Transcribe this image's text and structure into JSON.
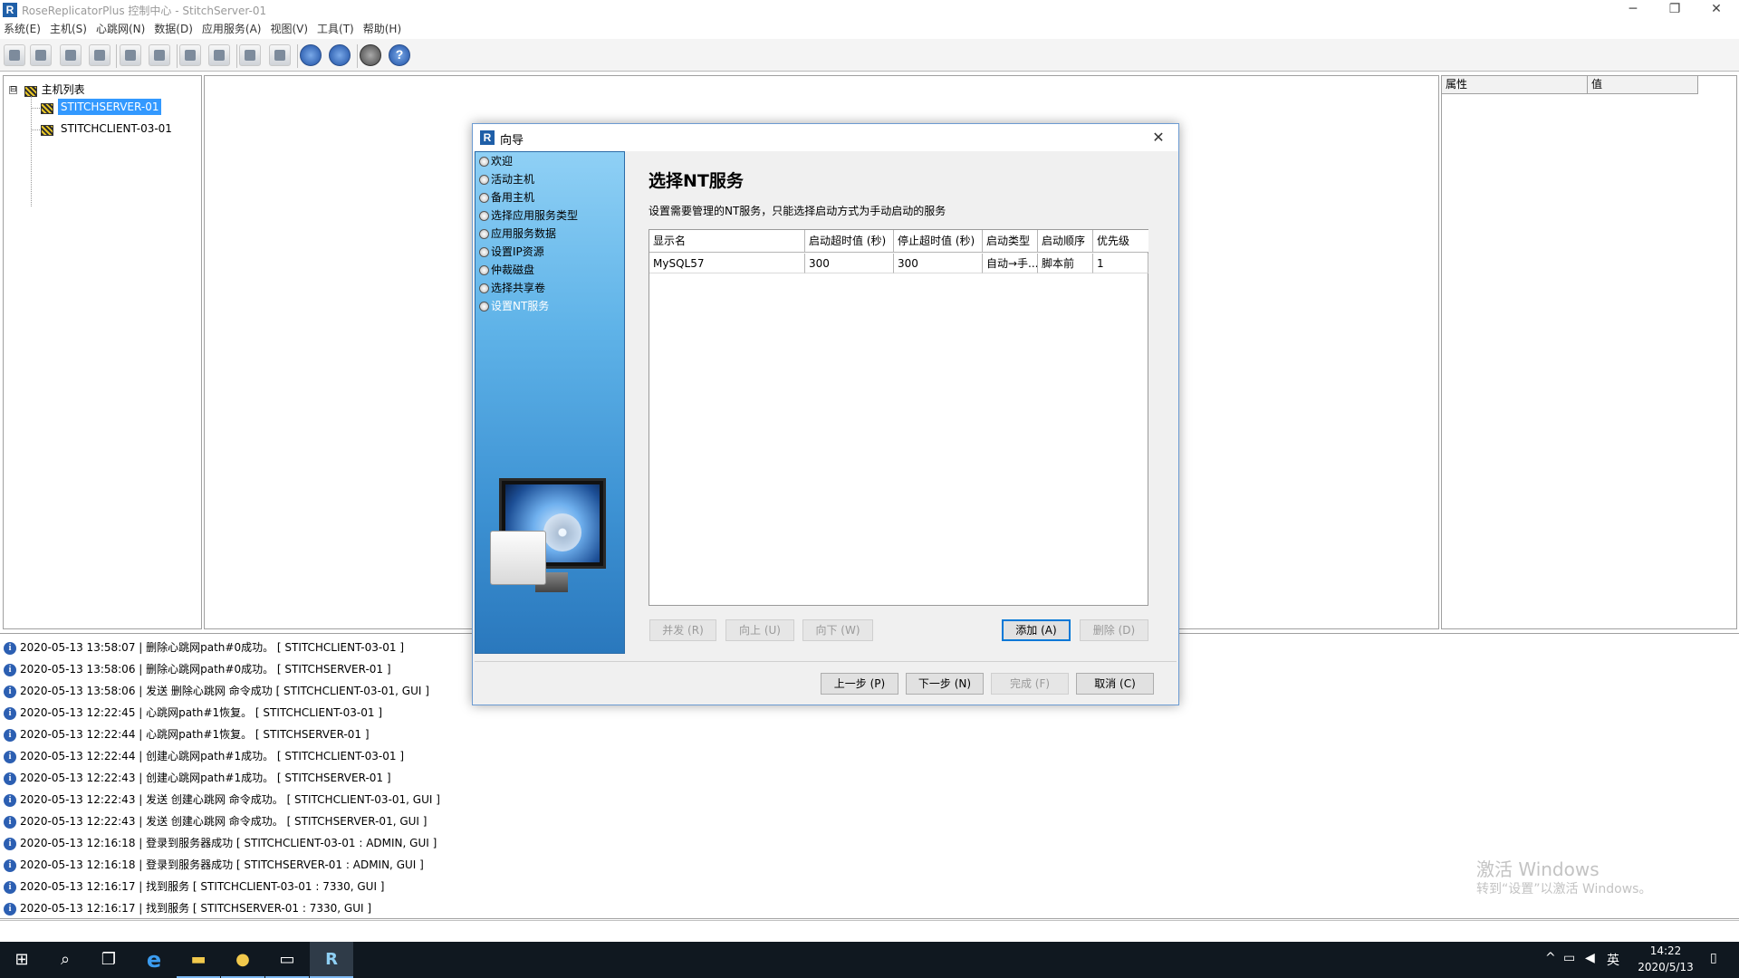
{
  "window": {
    "title": "RoseReplicatorPlus 控制中心   -   StitchServer-01",
    "icon_letter": "R",
    "minimize_glyph": "─",
    "restore_glyph": "❐",
    "close_glyph": "✕"
  },
  "menu": [
    "系统(E)",
    "主机(S)",
    "心跳网(N)",
    "数据(D)",
    "应用服务(A)",
    "视图(V)",
    "工具(T)",
    "帮助(H)"
  ],
  "toolbar": {
    "icons": [
      "key-icon",
      "console-icon",
      "server-icon",
      "settings-gear-icon",
      "download-icon",
      "upload-icon",
      "monitor-out-icon",
      "monitor-in-icon",
      "copy-icon",
      "paste-icon",
      "globe-icon",
      "globe-star-icon",
      "refresh-icon",
      "help-icon"
    ],
    "help_glyph": "?"
  },
  "tree": {
    "expander": "⊟",
    "root_label": "主机列表",
    "items": [
      {
        "label": "STITCHSERVER-01",
        "selected": true
      },
      {
        "label": "STITCHCLIENT-03-01",
        "selected": false
      }
    ]
  },
  "properties": {
    "col_property": "属性",
    "col_value": "值"
  },
  "wizard": {
    "title": "向导",
    "icon_letter": "R",
    "close_glyph": "✕",
    "steps": [
      {
        "label": "欢迎",
        "current": false
      },
      {
        "label": "活动主机",
        "current": false
      },
      {
        "label": "备用主机",
        "current": false
      },
      {
        "label": "选择应用服务类型",
        "current": false
      },
      {
        "label": "应用服务数据",
        "current": false
      },
      {
        "label": "设置IP资源",
        "current": false
      },
      {
        "label": "仲裁磁盘",
        "current": false
      },
      {
        "label": "选择共享卷",
        "current": false
      },
      {
        "label": "设置NT服务",
        "current": true
      }
    ],
    "page_title": "选择NT服务",
    "page_desc": "设置需要管理的NT服务，只能选择启动方式为手动启动的服务",
    "columns": [
      "显示名",
      "启动超时值 (秒)",
      "停止超时值 (秒)",
      "启动类型",
      "启动顺序",
      "优先级"
    ],
    "rows": [
      [
        "MySQL57",
        "300",
        "300",
        "自动→手...",
        "脚本前",
        "1"
      ]
    ],
    "buttons": {
      "parallel": "并发 (R)",
      "up": "向上 (U)",
      "down": "向下 (W)",
      "add": "添加 (A)",
      "delete": "删除 (D)",
      "back": "上一步 (P)",
      "next": "下一步 (N)",
      "finish": "完成 (F)",
      "cancel": "取消 (C)"
    }
  },
  "log": {
    "info_glyph": "i",
    "entries": [
      "2020-05-13 13:58:07 | 删除心跳网path#0成功。  [ STITCHCLIENT-03-01 ]",
      "2020-05-13 13:58:06 | 删除心跳网path#0成功。  [ STITCHSERVER-01 ]",
      "2020-05-13 13:58:06 | 发送 删除心跳网 命令成功  [ STITCHCLIENT-03-01, GUI ]",
      "2020-05-13 12:22:45 | 心跳网path#1恢复。  [ STITCHCLIENT-03-01 ]",
      "2020-05-13 12:22:44 | 心跳网path#1恢复。  [ STITCHSERVER-01 ]",
      "2020-05-13 12:22:44 | 创建心跳网path#1成功。  [ STITCHCLIENT-03-01 ]",
      "2020-05-13 12:22:43 | 创建心跳网path#1成功。  [ STITCHSERVER-01 ]",
      "2020-05-13 12:22:43 | 发送 创建心跳网 命令成功。  [ STITCHCLIENT-03-01, GUI ]",
      "2020-05-13 12:22:43 | 发送 创建心跳网 命令成功。  [ STITCHSERVER-01, GUI ]",
      "2020-05-13 12:16:18 | 登录到服务器成功  [ STITCHCLIENT-03-01 : ADMIN, GUI ]",
      "2020-05-13 12:16:18 | 登录到服务器成功  [ STITCHSERVER-01 : ADMIN, GUI ]",
      "2020-05-13 12:16:17 | 找到服务  [ STITCHCLIENT-03-01 : 7330, GUI ]",
      "2020-05-13 12:16:17 | 找到服务  [ STITCHSERVER-01 : 7330, GUI ]"
    ]
  },
  "watermark": {
    "line1": "激活 Windows",
    "line2": "转到“设置”以激活 Windows。"
  },
  "taskbar": {
    "start_glyph": "⊞",
    "search_glyph": "⌕",
    "taskview_glyph": "❐",
    "ie_glyph": "e",
    "explorer_glyph": "▬",
    "app_glyph": "●",
    "terminal_glyph": "▭",
    "rose_glyph": "R",
    "tray_arrow": "^",
    "tray_network": "▭",
    "tray_volume": "◀",
    "ime": "英",
    "time": "14:22",
    "date": "2020/5/13",
    "notification_glyph": "▯"
  },
  "colors": {
    "selection": "#3399ff",
    "wizard_sidebar": "#5fb3e8",
    "taskbar": "#101820",
    "info_icon": "#2c5fb2"
  }
}
